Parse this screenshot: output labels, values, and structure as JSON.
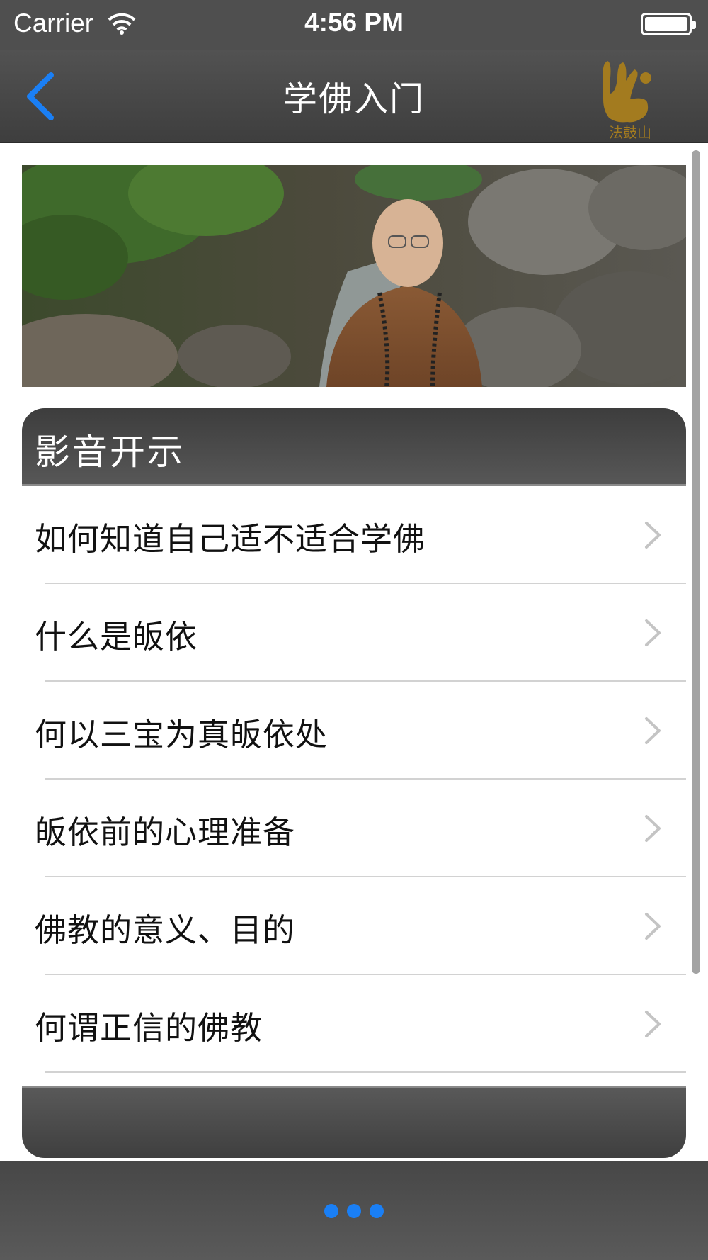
{
  "status_bar": {
    "carrier": "Carrier",
    "time": "4:56 PM"
  },
  "nav": {
    "title": "学佛入门",
    "back_icon": "chevron-left-icon",
    "logo_text": "法鼓山"
  },
  "banner": {
    "description": "monk-by-stream-photo"
  },
  "section": {
    "title": "影音开示",
    "items": [
      {
        "label": "如何知道自己适不适合学佛"
      },
      {
        "label": "什么是皈依"
      },
      {
        "label": "何以三宝为真皈依处"
      },
      {
        "label": "皈依前的心理准备"
      },
      {
        "label": "佛教的意义、目的"
      },
      {
        "label": "何谓正信的佛教"
      }
    ]
  },
  "colors": {
    "accent": "#1a7ff5",
    "bar": "#4f4f4f",
    "logo_gold": "#a37b1f"
  }
}
